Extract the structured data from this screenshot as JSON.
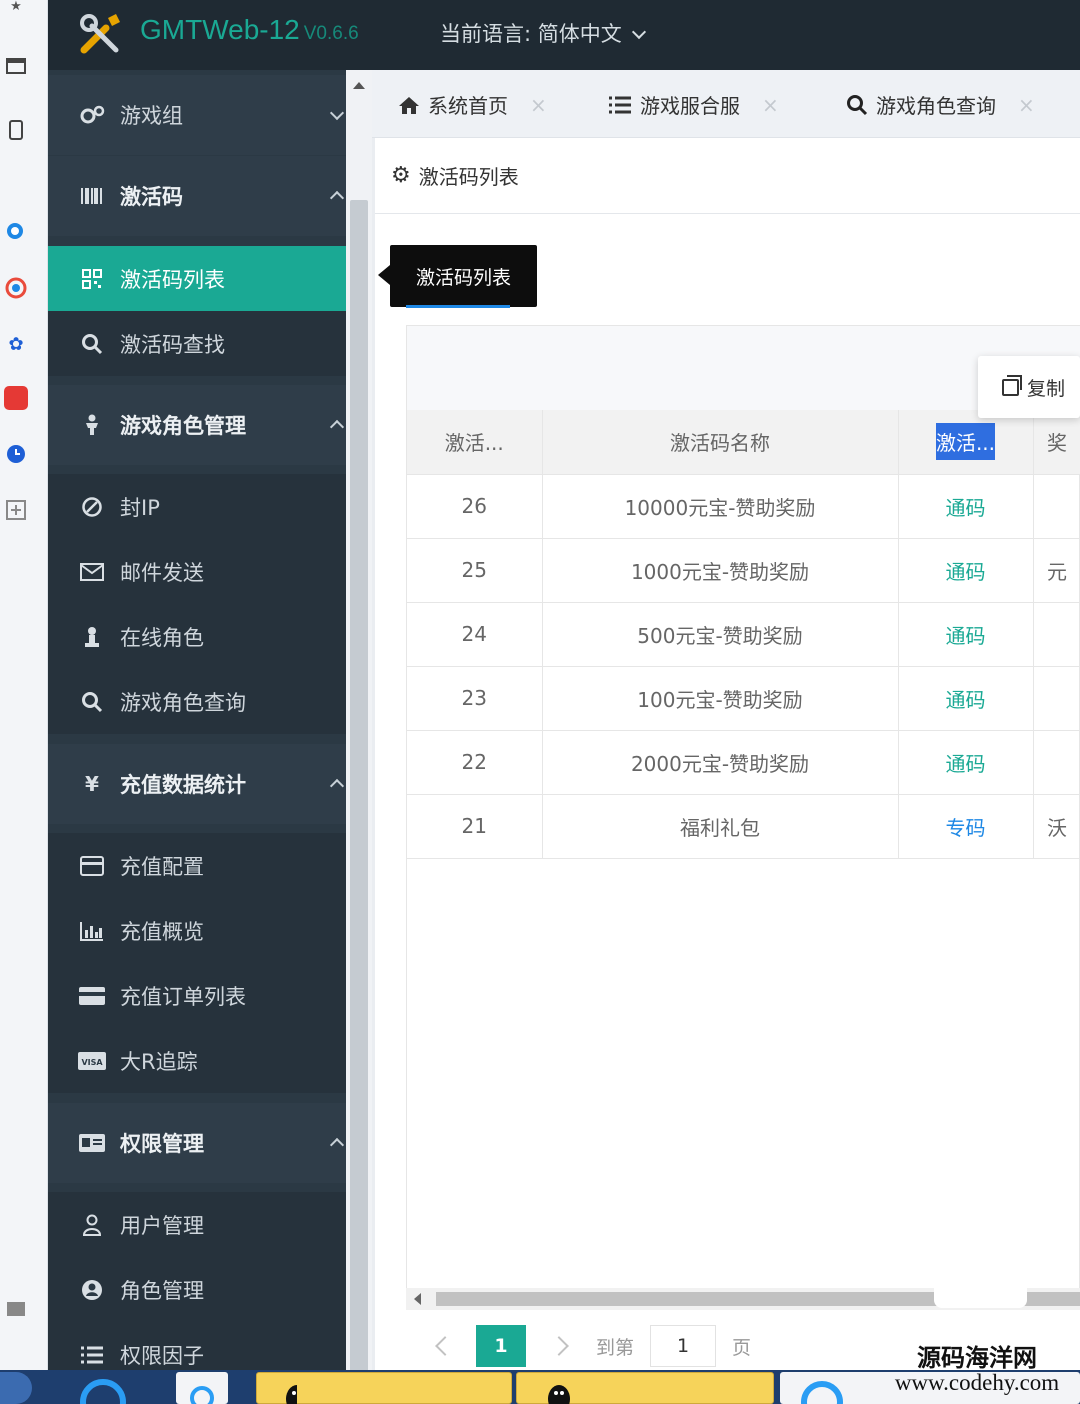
{
  "app": {
    "brand": "GMTWeb-12",
    "version": "V0.6.6",
    "language_label": "当前语言: 简体中文"
  },
  "sidebar": {
    "items": [
      {
        "label": "游戏组",
        "kind": "group",
        "icon": "gears-icon",
        "expanded": false
      },
      {
        "label": "激活码",
        "kind": "group",
        "icon": "barcode-icon",
        "expanded": true
      },
      {
        "label": "激活码列表",
        "kind": "sub",
        "icon": "qrcode-icon",
        "active": true
      },
      {
        "label": "激活码查找",
        "kind": "sub",
        "icon": "search-icon"
      },
      {
        "label": "游戏角色管理",
        "kind": "group",
        "icon": "user-icon",
        "expanded": true
      },
      {
        "label": "封IP",
        "kind": "sub",
        "icon": "ban-icon"
      },
      {
        "label": "邮件发送",
        "kind": "sub",
        "icon": "envelope-icon"
      },
      {
        "label": "在线角色",
        "kind": "sub",
        "icon": "user-online-icon"
      },
      {
        "label": "游戏角色查询",
        "kind": "sub",
        "icon": "search-icon"
      },
      {
        "label": "充值数据统计",
        "kind": "group",
        "icon": "yen-icon",
        "expanded": true
      },
      {
        "label": "充值配置",
        "kind": "sub",
        "icon": "card-icon"
      },
      {
        "label": "充值概览",
        "kind": "sub",
        "icon": "bar-chart-icon"
      },
      {
        "label": "充值订单列表",
        "kind": "sub",
        "icon": "credit-card-icon"
      },
      {
        "label": "大R追踪",
        "kind": "sub",
        "icon": "visa-icon"
      },
      {
        "label": "权限管理",
        "kind": "group",
        "icon": "id-card-icon",
        "expanded": true
      },
      {
        "label": "用户管理",
        "kind": "sub",
        "icon": "user-outline-icon"
      },
      {
        "label": "角色管理",
        "kind": "sub",
        "icon": "user-circle-icon"
      },
      {
        "label": "权限因子",
        "kind": "sub",
        "icon": "list-icon"
      }
    ]
  },
  "tabs": [
    {
      "label": "系统首页",
      "icon": "home-icon"
    },
    {
      "label": "游戏服合服",
      "icon": "list-icon"
    },
    {
      "label": "游戏角色查询",
      "icon": "search-icon"
    }
  ],
  "panel": {
    "title": "激活码列表"
  },
  "tooltip": {
    "text": "激活码列表"
  },
  "copy_button": {
    "label": "复制"
  },
  "table": {
    "headers": [
      "激活...",
      "激活码名称",
      "激活...",
      "奖"
    ],
    "rows": [
      {
        "id": "26",
        "name": "10000元宝-赞助奖励",
        "type": "通码",
        "type_style": "green",
        "extra": ""
      },
      {
        "id": "25",
        "name": "1000元宝-赞助奖励",
        "type": "通码",
        "type_style": "green",
        "extra": "元"
      },
      {
        "id": "24",
        "name": "500元宝-赞助奖励",
        "type": "通码",
        "type_style": "green",
        "extra": ""
      },
      {
        "id": "23",
        "name": "100元宝-赞助奖励",
        "type": "通码",
        "type_style": "green",
        "extra": ""
      },
      {
        "id": "22",
        "name": "2000元宝-赞助奖励",
        "type": "通码",
        "type_style": "green",
        "extra": ""
      },
      {
        "id": "21",
        "name": "福利礼包",
        "type": "专码",
        "type_style": "blue",
        "extra": "沃"
      }
    ]
  },
  "pager": {
    "current": "1",
    "goto_label": "到第",
    "goto_value": "1",
    "page_label": "页"
  },
  "watermark": {
    "line1": "源码海洋网",
    "line2": "www.codehy.com"
  },
  "colors": {
    "accent": "#1aa994",
    "link_blue": "#1e88e5",
    "topbar": "#1f2a33",
    "sidebar": "#2b3944"
  }
}
